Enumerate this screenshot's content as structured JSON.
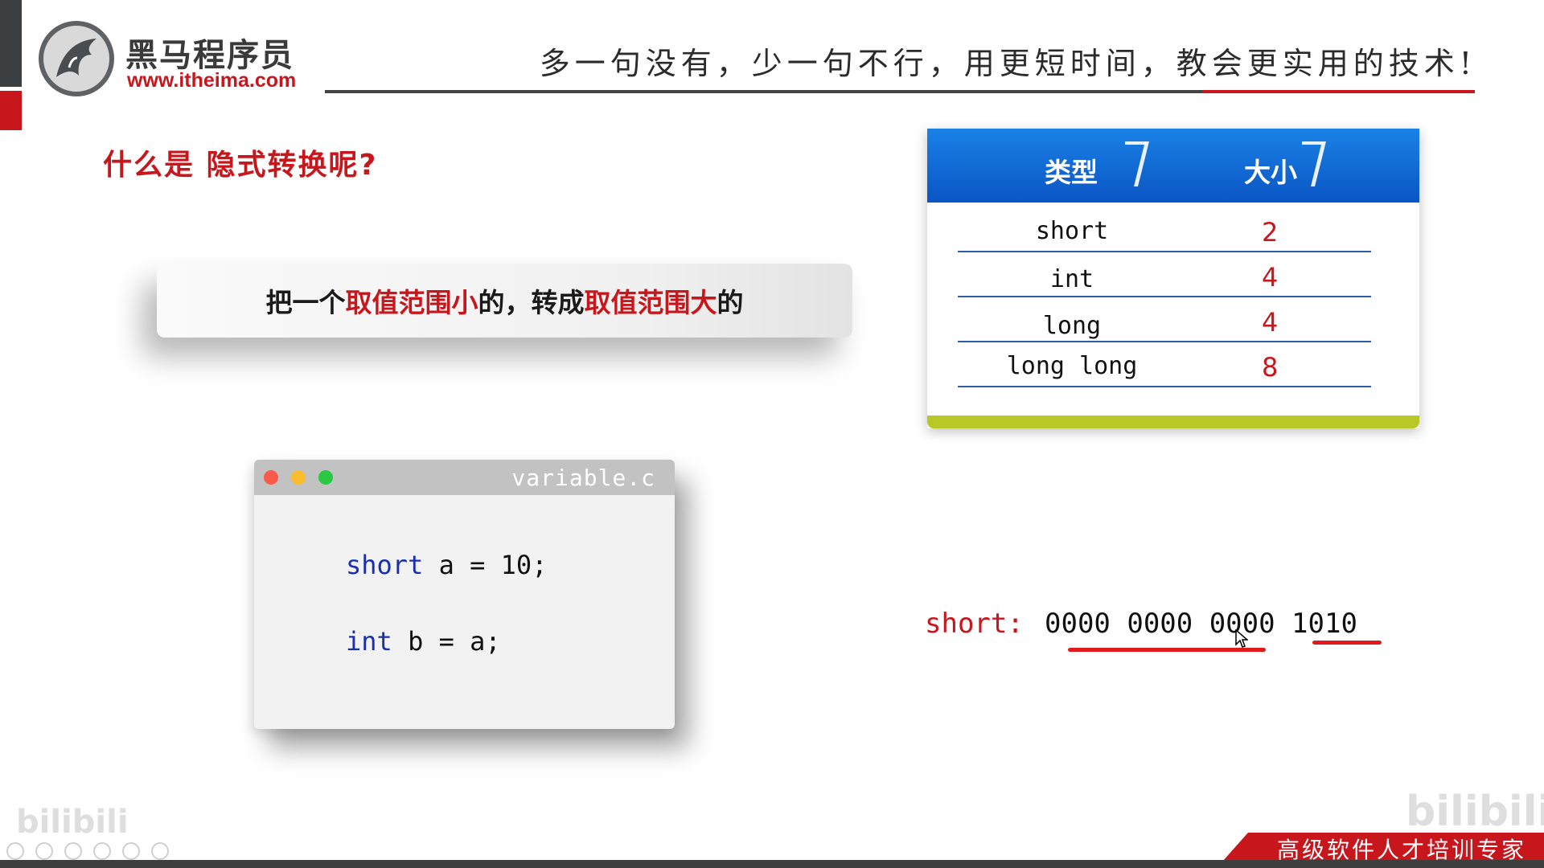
{
  "header": {
    "logo_name": "黑马程序员",
    "logo_url": "www.itheima.com",
    "slogan": "多一句没有，少一句不行，用更短时间，教会更实用的技术!"
  },
  "slide": {
    "question": "什么是 隐式转换呢?",
    "definition": {
      "p1": "把一个",
      "h1": "取值范围小",
      "p2": "的，转成",
      "h2": "取值范围大",
      "p3": "的"
    }
  },
  "code_window": {
    "filename": "variable.c",
    "lines": [
      {
        "keyword": "short",
        "rest": " a = 10;"
      },
      {
        "keyword": "int",
        "rest": " b = a;"
      }
    ]
  },
  "size_table": {
    "headers": {
      "type": "类型",
      "size": "大小"
    },
    "rows": [
      {
        "type": "short",
        "size": "2"
      },
      {
        "type": "int",
        "size": "4"
      },
      {
        "type": "long",
        "size": "4"
      },
      {
        "type": "long long",
        "size": "8"
      }
    ]
  },
  "binary": {
    "label": "short:",
    "value": "0000 0000 0000 1010"
  },
  "footer": {
    "tagline": "高级软件人才培训专家",
    "watermark": "bilibili"
  },
  "colors": {
    "brand_red": "#c8161d",
    "table_blue": "#0a55c4",
    "table_footer_green": "#b8c826",
    "keyword_blue": "#1a2fb0"
  }
}
